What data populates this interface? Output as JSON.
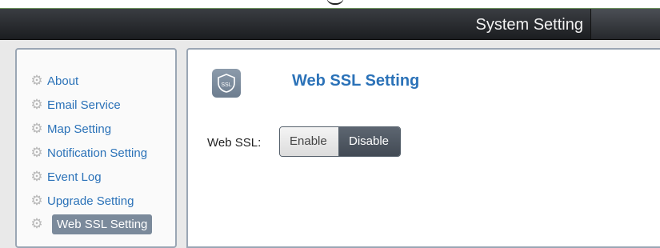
{
  "header": {
    "title": "System Setting"
  },
  "sidebar": {
    "items": [
      {
        "label": "About",
        "icon": "gear-icon"
      },
      {
        "label": "Email Service",
        "icon": "gear-icon"
      },
      {
        "label": "Map Setting",
        "icon": "gear-icon"
      },
      {
        "label": "Notification Setting",
        "icon": "gear-icon"
      },
      {
        "label": "Event Log",
        "icon": "gear-icon"
      },
      {
        "label": "Upgrade Setting",
        "icon": "gear-icon"
      },
      {
        "label": "Web SSL Setting",
        "icon": "gear-icon",
        "active": true
      }
    ]
  },
  "main": {
    "title": "Web SSL Setting",
    "icon": "ssl-shield-icon",
    "web_ssl": {
      "label": "Web SSL:",
      "options": [
        "Enable",
        "Disable"
      ],
      "selected": "Disable"
    }
  },
  "colors": {
    "link_blue": "#2b72b8",
    "active_bg": "#7b8a9b",
    "titlebar_bg": "#1b1d20"
  }
}
